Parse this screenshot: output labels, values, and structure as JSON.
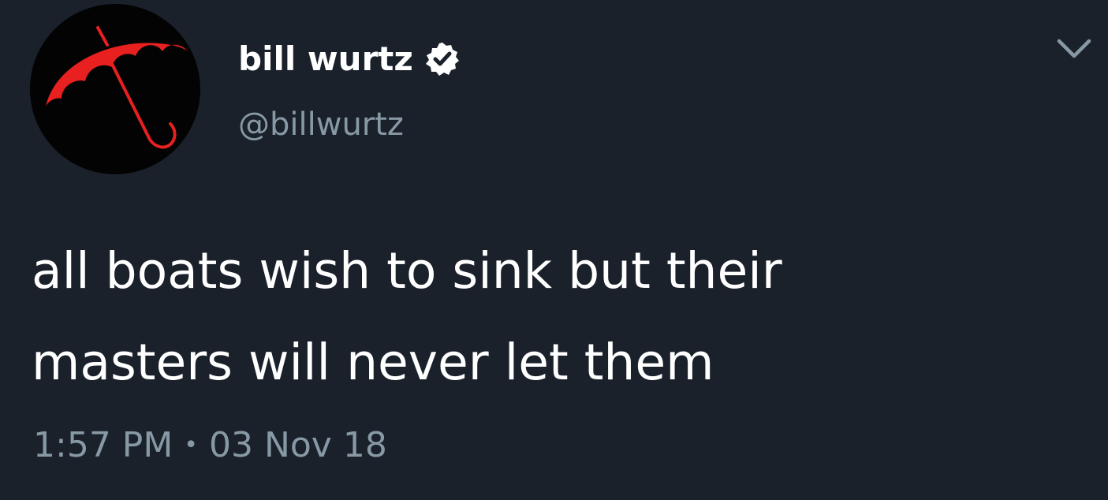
{
  "tweet": {
    "author": {
      "display_name": "bill wurtz",
      "handle": "@billwurtz",
      "verified": true,
      "verified_icon": "verified-badge-icon",
      "avatar_icon": "red-umbrella-icon"
    },
    "text_lines": [
      "all boats wish to sink but their",
      "masters will never let them"
    ],
    "time": "1:57 PM",
    "separator": "•",
    "date": "03 Nov 18",
    "menu_icon": "chevron-down-icon"
  },
  "colors": {
    "background": "#1a212b",
    "text": "#ffffff",
    "secondary_text": "#8899a6",
    "avatar_background": "#030303",
    "umbrella": "#e8201f"
  }
}
